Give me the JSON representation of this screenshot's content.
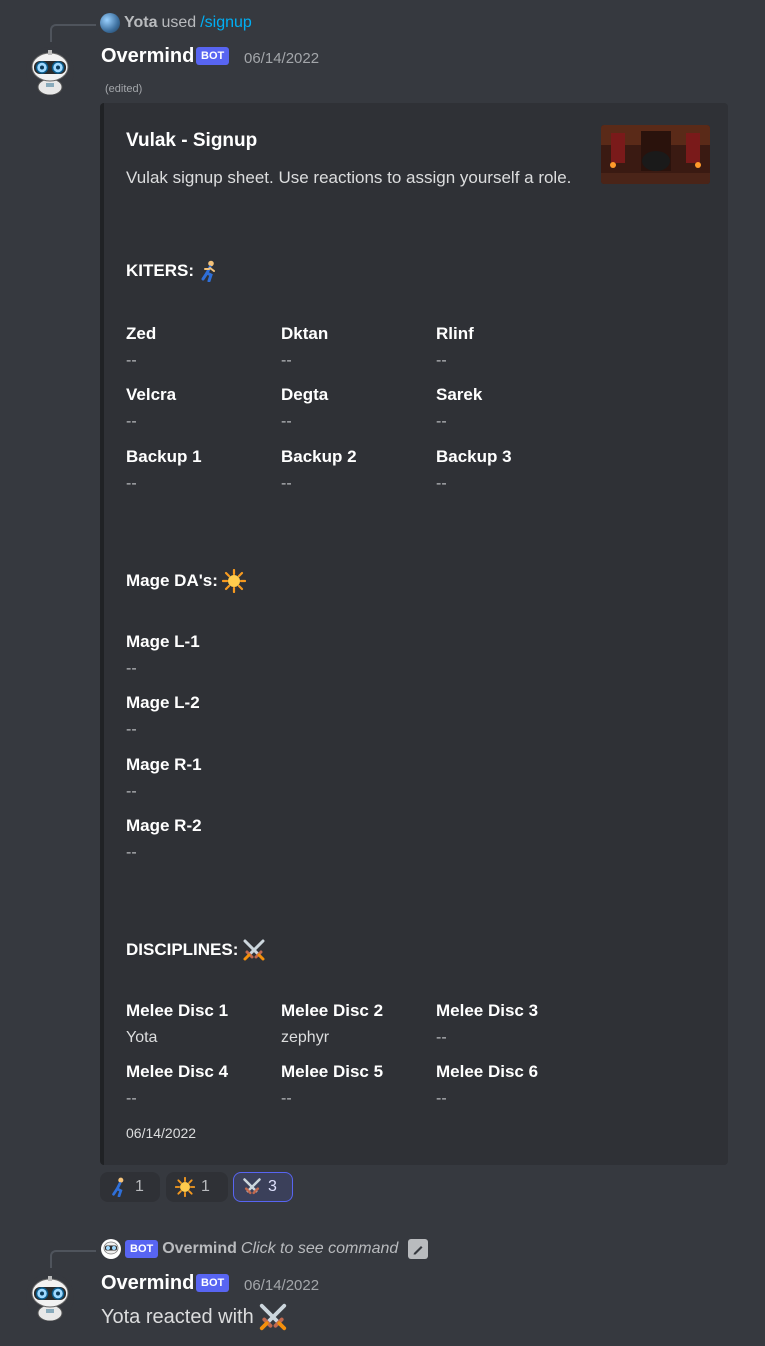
{
  "message1": {
    "reply": {
      "user": "Yota",
      "used_text": "used",
      "command": "/signup"
    },
    "author": "Overmind",
    "bot_tag": "BOT",
    "timestamp": "06/14/2022",
    "edited": "(edited)",
    "embed": {
      "title": "Vulak - Signup",
      "description": "Vulak signup sheet. Use reactions to assign yourself a role.",
      "sections": [
        {
          "heading": "KITERS:",
          "icon": "runner-emoji",
          "fields": [
            {
              "name": "Zed",
              "value": "--"
            },
            {
              "name": "Dktan",
              "value": "--"
            },
            {
              "name": "Rlinf",
              "value": "--"
            },
            {
              "name": "Velcra",
              "value": "--"
            },
            {
              "name": "Degta",
              "value": "--"
            },
            {
              "name": "Sarek",
              "value": "--"
            },
            {
              "name": "Backup 1",
              "value": "--"
            },
            {
              "name": "Backup 2",
              "value": "--"
            },
            {
              "name": "Backup 3",
              "value": "--"
            }
          ]
        },
        {
          "heading": "Mage DA's:",
          "icon": "sun-emoji",
          "fields": [
            {
              "name": "Mage L-1",
              "value": "--"
            },
            {
              "name": "Mage L-2",
              "value": "--"
            },
            {
              "name": "Mage R-1",
              "value": "--"
            },
            {
              "name": "Mage R-2",
              "value": "--"
            }
          ]
        },
        {
          "heading": "DISCIPLINES:",
          "icon": "crossed-swords-emoji",
          "fields": [
            {
              "name": "Melee Disc 1",
              "value": "Yota"
            },
            {
              "name": "Melee Disc 2",
              "value": "zephyr"
            },
            {
              "name": "Melee Disc 3",
              "value": "--"
            },
            {
              "name": "Melee Disc 4",
              "value": "--"
            },
            {
              "name": "Melee Disc 5",
              "value": "--"
            },
            {
              "name": "Melee Disc 6",
              "value": "--"
            }
          ]
        }
      ],
      "footer": "06/14/2022"
    },
    "reactions": [
      {
        "emoji": "runner-emoji",
        "count": "1",
        "active": false
      },
      {
        "emoji": "sun-emoji",
        "count": "1",
        "active": false
      },
      {
        "emoji": "crossed-swords-emoji",
        "count": "3",
        "active": true
      }
    ]
  },
  "message2": {
    "reply": {
      "bot_tag": "BOT",
      "user": "Overmind",
      "click_text": "Click to see command"
    },
    "author": "Overmind",
    "bot_tag": "BOT",
    "timestamp": "06/14/2022",
    "text": "Yota reacted with",
    "text_icon": "crossed-swords-emoji"
  },
  "colors": {
    "background": "#36393f",
    "embed_bg": "#2f3136",
    "bot_tag": "#5865f2",
    "link": "#00aff4"
  }
}
